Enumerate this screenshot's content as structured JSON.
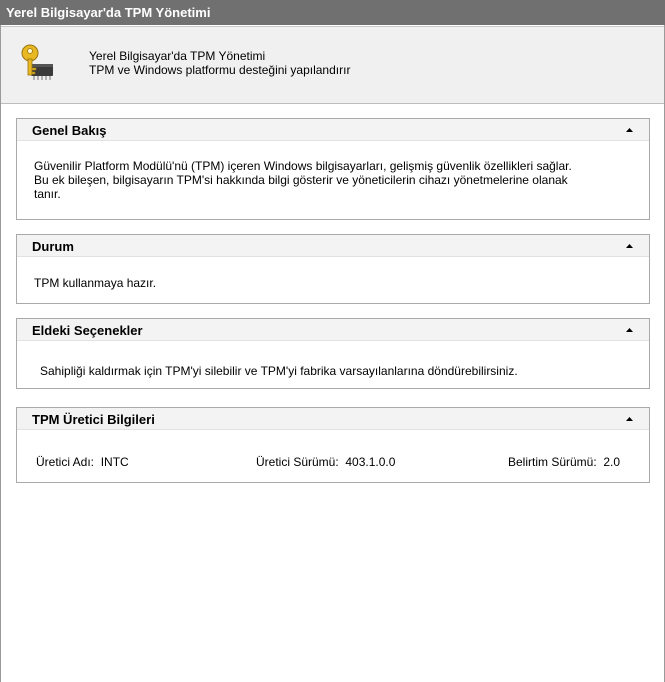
{
  "window": {
    "title": "Yerel Bilgisayar'da TPM Yönetimi"
  },
  "header": {
    "icon": "key-chip-icon",
    "line1": "Yerel Bilgisayar'da TPM Yönetimi",
    "line2": "TPM ve Windows platformu desteğini yapılandırır"
  },
  "sections": {
    "overview": {
      "title": "Genel Bakış",
      "line1": "Güvenilir Platform Modülü'nü (TPM) içeren Windows bilgisayarları, gelişmiş güvenlik özellikleri sağlar.",
      "line2": "Bu ek bileşen, bilgisayarın TPM'si hakkında bilgi gösterir ve yöneticilerin cihazı yönetmelerine olanak",
      "line3": "tanır."
    },
    "status": {
      "title": "Durum",
      "text": "TPM kullanmaya hazır."
    },
    "actions": {
      "title": "Eldeki Seçenekler",
      "text": "Sahipliği kaldırmak için TPM'yi silebilir ve TPM'yi fabrika varsayılanlarına döndürebilirsiniz."
    },
    "manufacturer": {
      "title": "TPM Üretici Bilgileri",
      "name_label": "Üretici Adı:",
      "name_value": "INTC",
      "version_label": "Üretici Sürümü:",
      "version_value": "403.1.0.0",
      "spec_label": "Belirtim Sürümü:",
      "spec_value": "2.0"
    }
  },
  "colors": {
    "titlebar": "#707070",
    "header_bg": "#f0f0f0",
    "section_border": "#a9a9a9"
  }
}
